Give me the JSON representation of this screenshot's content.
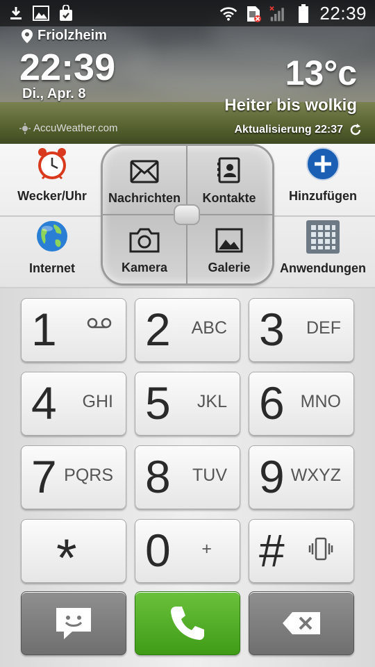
{
  "status_bar": {
    "time": "22:39",
    "left_icons": [
      "download-icon",
      "image-icon",
      "shopping-bag-icon"
    ],
    "right_icons": [
      "wifi-icon",
      "no-sim-icon",
      "no-signal-icon",
      "battery-icon"
    ]
  },
  "weather": {
    "location": "Friolzheim",
    "time": "22:39",
    "date": "Di., Apr. 8",
    "brand": "AccuWeather.com",
    "temperature": "13°c",
    "condition": "Heiter bis wolkig",
    "updated": "Aktualisierung 22:37"
  },
  "apps": {
    "alarm": "Wecker/Uhr",
    "messages": "Nachrichten",
    "contacts": "Kontakte",
    "add": "Hinzufügen",
    "internet": "Internet",
    "camera": "Kamera",
    "gallery": "Galerie",
    "applications": "Anwendungen"
  },
  "dialpad": {
    "keys": [
      {
        "digit": "1",
        "letters": ""
      },
      {
        "digit": "2",
        "letters": "ABC"
      },
      {
        "digit": "3",
        "letters": "DEF"
      },
      {
        "digit": "4",
        "letters": "GHI"
      },
      {
        "digit": "5",
        "letters": "JKL"
      },
      {
        "digit": "6",
        "letters": "MNO"
      },
      {
        "digit": "7",
        "letters": "PQRS"
      },
      {
        "digit": "8",
        "letters": "TUV"
      },
      {
        "digit": "9",
        "letters": "WXYZ"
      },
      {
        "digit": "*",
        "letters": ""
      },
      {
        "digit": "0",
        "letters": "+"
      },
      {
        "digit": "#",
        "letters": ""
      }
    ],
    "key1_icon": "voicemail-icon",
    "hash_icon": "vibrate-icon",
    "message_icon": "sms-icon",
    "call_icon": "phone-icon",
    "backspace_icon": "backspace-icon"
  },
  "colors": {
    "call_green": "#4caf1f",
    "add_blue": "#1a5fb4",
    "alarm_red": "#d93a1e"
  }
}
